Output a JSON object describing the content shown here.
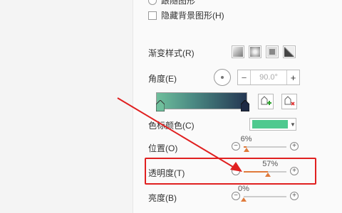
{
  "panel": {
    "top_option_label": "跟随图形",
    "hide_bg_label": "隐藏背景图形(H)",
    "gradient_style_label": "渐变样式(R)",
    "angle_label": "角度(E)",
    "angle_value": "90.0°",
    "stop_color_label": "色标颜色(C)",
    "position_label": "位置(O)",
    "transparency_label": "透明度(T)",
    "brightness_label": "亮度(B)"
  },
  "sliders": {
    "position": {
      "percent_label": "6%",
      "value": 6
    },
    "transparency": {
      "percent_label": "57%",
      "value": 57
    },
    "brightness": {
      "percent_label": "0%",
      "value": 0
    }
  },
  "colors": {
    "stop_color": "#4fc98f",
    "accent_orange": "#e07a3b",
    "annotation_red": "#e02020"
  },
  "icons": {
    "add_stop": "add-stop-icon",
    "delete_stop": "delete-stop-icon"
  }
}
